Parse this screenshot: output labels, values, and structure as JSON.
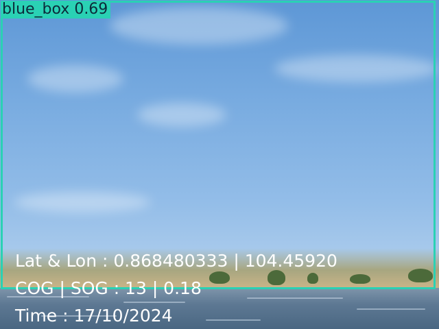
{
  "detection": {
    "label": "blue_box 0.69",
    "color": "#2ad1b4"
  },
  "telemetry": {
    "lat_lon": "Lat & Lon : 0.868480333 | 104.45920",
    "cog_sog": "COG | SOG : 13 | 0.18",
    "time": "Time : 17/10/2024"
  }
}
